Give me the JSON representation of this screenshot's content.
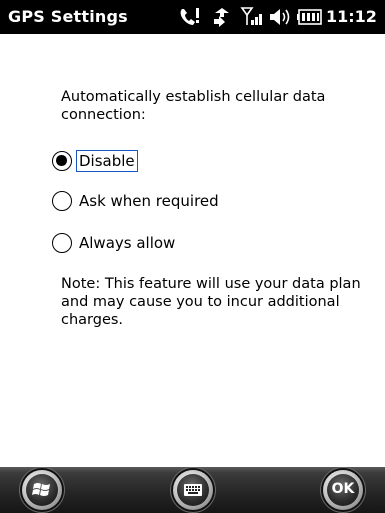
{
  "window": {
    "title": "GPS Settings",
    "clock": "11:12"
  },
  "status_icons": [
    "phone-alert-icon",
    "data-connection-icon",
    "signal-strength-icon",
    "speaker-icon",
    "battery-icon"
  ],
  "settings": {
    "prompt": "Automatically establish cellular data connection:",
    "options": [
      {
        "label": "Disable",
        "selected": true
      },
      {
        "label": "Ask when required",
        "selected": false
      },
      {
        "label": "Always allow",
        "selected": false
      }
    ],
    "note": "Note: This feature will use your data plan and may cause you to incur additional charges."
  },
  "softkeys": {
    "left_icon": "windows-start-icon",
    "center_icon": "keyboard-icon",
    "right_label": "OK"
  }
}
